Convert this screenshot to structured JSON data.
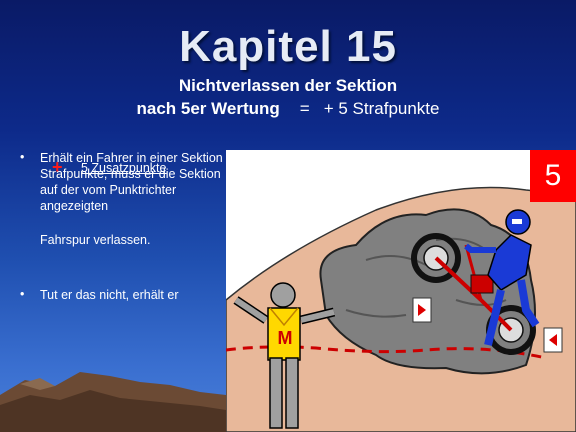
{
  "title": "Kapitel  15",
  "subtitle_line1": "Nichtverlassen der Sektion",
  "subtitle_line2_left": "nach 5er Wertung",
  "subtitle_equals": "=",
  "subtitle_line2_right": "+ 5 Strafpunkte",
  "bullets": [
    {
      "marker": "•",
      "text_a": "Erhält ein Fahrer in einer Sektion 5 Strafpunkte, muss er die Sektion auf  der vom Punktrichter angezeigten",
      "text_b": "Fahrspur verlassen."
    },
    {
      "marker": "•",
      "text_a": "Tut er das nicht, erhält er"
    }
  ],
  "extra_plus": "+",
  "extra_points": "5 Zusatzpunkte",
  "badge": "5",
  "marshal_letter": "M",
  "colors": {
    "background_top": "#0a1a66",
    "background_bottom": "#4a7fd8",
    "panel": "#ffffff",
    "ground": "#e8b89a",
    "rock": "#7f7f7f",
    "badge": "#ff0000",
    "boundary_line": "#cc0000",
    "rider": "#1a3ad6",
    "vest": "#ffd800"
  }
}
